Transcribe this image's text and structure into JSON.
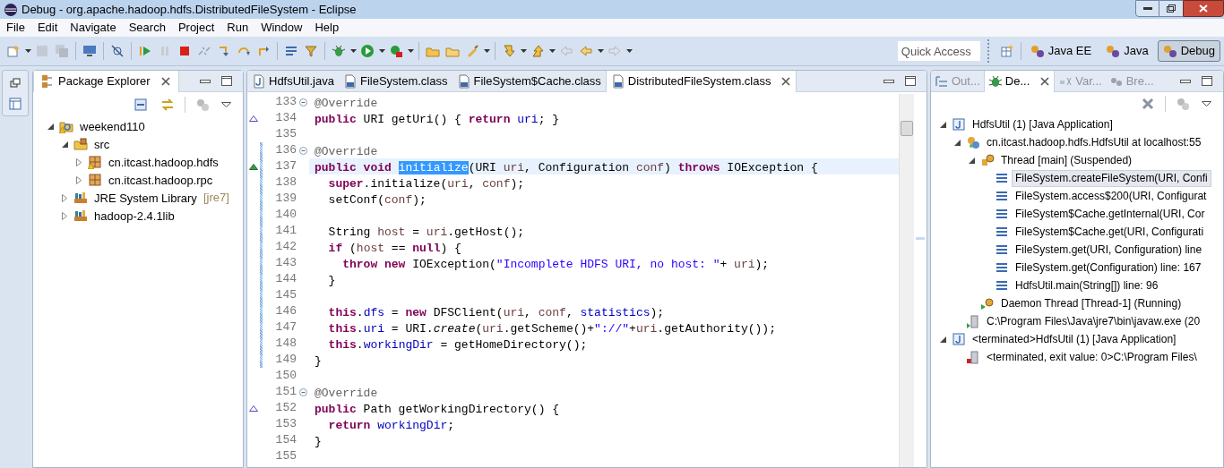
{
  "window": {
    "title": "Debug - org.apache.hadoop.hdfs.DistributedFileSystem - Eclipse"
  },
  "menu": [
    "File",
    "Edit",
    "Navigate",
    "Search",
    "Project",
    "Run",
    "Window",
    "Help"
  ],
  "quick_access": {
    "placeholder": "Quick Access"
  },
  "perspectives": [
    {
      "label": "Java EE",
      "selected": false
    },
    {
      "label": "Java",
      "selected": false
    },
    {
      "label": "Debug",
      "selected": true
    }
  ],
  "package_explorer": {
    "tabs": [
      {
        "label": "Package Explorer",
        "selected": true
      }
    ],
    "tree": [
      {
        "label": "weekend110",
        "kind": "project",
        "warning": true,
        "expanded": true,
        "children": [
          {
            "label": "src",
            "kind": "source-folder",
            "warning": false,
            "expanded": true,
            "children": [
              {
                "label": "cn.itcast.hadoop.hdfs",
                "kind": "package",
                "warning": true,
                "expanded": false
              },
              {
                "label": "cn.itcast.hadoop.rpc",
                "kind": "package",
                "warning": false,
                "expanded": false
              }
            ]
          },
          {
            "label": "JRE System Library",
            "qualifier": "[jre7]",
            "kind": "library",
            "warning": false,
            "expanded": false
          },
          {
            "label": "hadoop-2.4.1lib",
            "kind": "library",
            "warning": false,
            "expanded": false
          }
        ]
      }
    ]
  },
  "editor": {
    "tabs": [
      {
        "label": "HdfsUtil.java",
        "kind": "java",
        "selected": false
      },
      {
        "label": "FileSystem.class",
        "kind": "class",
        "selected": false
      },
      {
        "label": "FileSystem$Cache.class",
        "kind": "class",
        "selected": false
      },
      {
        "label": "DistributedFileSystem.class",
        "kind": "class",
        "selected": true
      }
    ],
    "lines": [
      {
        "number": "133",
        "fold": true,
        "changed": false,
        "current": false,
        "tokens": [
          {
            "kind": "annotation",
            "text": "@Override"
          }
        ]
      },
      {
        "number": "134",
        "fold": false,
        "changed": false,
        "current": false,
        "marker": {
          "kind": "override"
        },
        "tokens": [
          {
            "kind": "keyword",
            "text": "public"
          },
          {
            "kind": "plain",
            "text": " URI getUri() { "
          },
          {
            "kind": "keyword",
            "text": "return"
          },
          {
            "kind": "field",
            "text": " uri"
          },
          {
            "kind": "plain",
            "text": "; }"
          }
        ]
      },
      {
        "number": "135",
        "fold": false,
        "changed": false,
        "current": false
      },
      {
        "number": "136",
        "fold": true,
        "changed": true,
        "current": false,
        "tokens": [
          {
            "kind": "annotation",
            "text": "@Override"
          }
        ]
      },
      {
        "number": "137",
        "fold": false,
        "changed": true,
        "current": true,
        "marker": {
          "kind": "implements"
        },
        "tokens": [
          {
            "kind": "keyword",
            "text": "public void "
          },
          {
            "kind": "selection",
            "text": "initialize"
          },
          {
            "kind": "plain",
            "text": "(URI "
          },
          {
            "kind": "variable",
            "text": "uri"
          },
          {
            "kind": "plain",
            "text": ", Configuration "
          },
          {
            "kind": "variable",
            "text": "conf"
          },
          {
            "kind": "plain",
            "text": ") "
          },
          {
            "kind": "keyword",
            "text": "throws"
          },
          {
            "kind": "plain",
            "text": " IOException {"
          }
        ]
      },
      {
        "number": "138",
        "fold": false,
        "changed": true,
        "current": false,
        "tokens": [
          {
            "kind": "keyword",
            "text": "  super"
          },
          {
            "kind": "plain",
            "text": ".initialize("
          },
          {
            "kind": "variable",
            "text": "uri"
          },
          {
            "kind": "plain",
            "text": ", "
          },
          {
            "kind": "variable",
            "text": "conf"
          },
          {
            "kind": "plain",
            "text": ");"
          }
        ]
      },
      {
        "number": "139",
        "fold": false,
        "changed": true,
        "current": false,
        "tokens": [
          {
            "kind": "plain",
            "text": "  setConf("
          },
          {
            "kind": "variable",
            "text": "conf"
          },
          {
            "kind": "plain",
            "text": ");"
          }
        ]
      },
      {
        "number": "140",
        "fold": false,
        "changed": true,
        "current": false
      },
      {
        "number": "141",
        "fold": false,
        "changed": true,
        "current": false,
        "tokens": [
          {
            "kind": "plain",
            "text": "  String "
          },
          {
            "kind": "variable",
            "text": "host"
          },
          {
            "kind": "plain",
            "text": " = "
          },
          {
            "kind": "variable",
            "text": "uri"
          },
          {
            "kind": "plain",
            "text": ".getHost();"
          }
        ]
      },
      {
        "number": "142",
        "fold": false,
        "changed": true,
        "current": false,
        "tokens": [
          {
            "kind": "keyword",
            "text": "  if"
          },
          {
            "kind": "plain",
            "text": " ("
          },
          {
            "kind": "variable",
            "text": "host"
          },
          {
            "kind": "plain",
            "text": " == "
          },
          {
            "kind": "keyword",
            "text": "null"
          },
          {
            "kind": "plain",
            "text": ") {"
          }
        ]
      },
      {
        "number": "143",
        "fold": false,
        "changed": true,
        "current": false,
        "tokens": [
          {
            "kind": "keyword",
            "text": "    throw new"
          },
          {
            "kind": "plain",
            "text": " IOException("
          },
          {
            "kind": "string",
            "text": "\"Incomplete HDFS URI, no host: \""
          },
          {
            "kind": "plain",
            "text": "+ "
          },
          {
            "kind": "variable",
            "text": "uri"
          },
          {
            "kind": "plain",
            "text": ");"
          }
        ]
      },
      {
        "number": "144",
        "fold": false,
        "changed": true,
        "current": false,
        "tokens": [
          {
            "kind": "plain",
            "text": "  }"
          }
        ]
      },
      {
        "number": "145",
        "fold": false,
        "changed": true,
        "current": false
      },
      {
        "number": "146",
        "fold": false,
        "changed": true,
        "current": false,
        "tokens": [
          {
            "kind": "keyword",
            "text": "  this"
          },
          {
            "kind": "plain",
            "text": "."
          },
          {
            "kind": "field",
            "text": "dfs"
          },
          {
            "kind": "plain",
            "text": " = "
          },
          {
            "kind": "keyword",
            "text": "new"
          },
          {
            "kind": "plain",
            "text": " DFSClient("
          },
          {
            "kind": "variable",
            "text": "uri"
          },
          {
            "kind": "plain",
            "text": ", "
          },
          {
            "kind": "variable",
            "text": "conf"
          },
          {
            "kind": "plain",
            "text": ", "
          },
          {
            "kind": "field",
            "text": "statistics"
          },
          {
            "kind": "plain",
            "text": ");"
          }
        ]
      },
      {
        "number": "147",
        "fold": false,
        "changed": true,
        "current": false,
        "tokens": [
          {
            "kind": "keyword",
            "text": "  this"
          },
          {
            "kind": "plain",
            "text": "."
          },
          {
            "kind": "field",
            "text": "uri"
          },
          {
            "kind": "plain",
            "text": " = URI."
          },
          {
            "kind": "static",
            "text": "create"
          },
          {
            "kind": "plain",
            "text": "("
          },
          {
            "kind": "variable",
            "text": "uri"
          },
          {
            "kind": "plain",
            "text": ".getScheme()+"
          },
          {
            "kind": "string",
            "text": "\"://\""
          },
          {
            "kind": "plain",
            "text": "+"
          },
          {
            "kind": "variable",
            "text": "uri"
          },
          {
            "kind": "plain",
            "text": ".getAuthority());"
          }
        ]
      },
      {
        "number": "148",
        "fold": false,
        "changed": true,
        "current": false,
        "tokens": [
          {
            "kind": "keyword",
            "text": "  this"
          },
          {
            "kind": "plain",
            "text": "."
          },
          {
            "kind": "field",
            "text": "workingDir"
          },
          {
            "kind": "plain",
            "text": " = getHomeDirectory();"
          }
        ]
      },
      {
        "number": "149",
        "fold": false,
        "changed": true,
        "current": false,
        "tokens": [
          {
            "kind": "plain",
            "text": "}"
          }
        ]
      },
      {
        "number": "150",
        "fold": false,
        "changed": false,
        "current": false
      },
      {
        "number": "151",
        "fold": true,
        "changed": false,
        "current": false,
        "tokens": [
          {
            "kind": "annotation",
            "text": "@Override"
          }
        ]
      },
      {
        "number": "152",
        "fold": false,
        "changed": false,
        "current": false,
        "marker": {
          "kind": "override"
        },
        "tokens": [
          {
            "kind": "keyword",
            "text": "public"
          },
          {
            "kind": "plain",
            "text": " Path getWorkingDirectory() {"
          }
        ]
      },
      {
        "number": "153",
        "fold": false,
        "changed": false,
        "current": false,
        "tokens": [
          {
            "kind": "keyword",
            "text": "  return"
          },
          {
            "kind": "field",
            "text": " workingDir"
          },
          {
            "kind": "plain",
            "text": ";"
          }
        ]
      },
      {
        "number": "154",
        "fold": false,
        "changed": false,
        "current": false,
        "tokens": [
          {
            "kind": "plain",
            "text": "}"
          }
        ]
      },
      {
        "number": "155",
        "fold": false,
        "changed": false,
        "current": false
      }
    ]
  },
  "debug_view": {
    "tabs": [
      {
        "label": "Out...",
        "kind": "outline",
        "selected": false
      },
      {
        "label": "De...",
        "kind": "debug",
        "selected": true
      },
      {
        "label": "Var...",
        "kind": "variables",
        "selected": false
      },
      {
        "label": "Bre...",
        "kind": "breakpoints",
        "selected": false
      }
    ],
    "tree": [
      {
        "label": "HdfsUtil (1) [Java Application]",
        "kind": "app",
        "expanded": true,
        "children": [
          {
            "label": "cn.itcast.hadoop.hdfs.HdfsUtil at localhost:55",
            "kind": "target",
            "expanded": true,
            "children": [
              {
                "label": "Thread [main] (Suspended)",
                "kind": "thread",
                "expanded": true,
                "children": [
                  {
                    "label": "FileSystem.createFileSystem(URI, Confi",
                    "kind": "frame",
                    "selected": true
                  },
                  {
                    "label": "FileSystem.access$200(URI, Configurat",
                    "kind": "frame",
                    "selected": false
                  },
                  {
                    "label": "FileSystem$Cache.getInternal(URI, Cor",
                    "kind": "frame",
                    "selected": false
                  },
                  {
                    "label": "FileSystem$Cache.get(URI, Configurati",
                    "kind": "frame",
                    "selected": false
                  },
                  {
                    "label": "FileSystem.get(URI, Configuration) line",
                    "kind": "frame",
                    "selected": false
                  },
                  {
                    "label": "FileSystem.get(Configuration) line: 167",
                    "kind": "frame",
                    "selected": false
                  },
                  {
                    "label": "HdfsUtil.main(String[]) line: 96",
                    "kind": "frame",
                    "selected": false
                  }
                ]
              },
              {
                "label": "Daemon Thread [Thread-1] (Running)",
                "kind": "daemon"
              }
            ]
          },
          {
            "label": "C:\\Program Files\\Java\\jre7\\bin\\javaw.exe (20",
            "kind": "process"
          }
        ]
      },
      {
        "label": "<terminated>HdfsUtil (1) [Java Application]",
        "kind": "app",
        "expanded": true,
        "children": [
          {
            "label": "<terminated, exit value: 0>C:\\Program Files\\",
            "kind": "terminated-process"
          }
        ]
      }
    ]
  }
}
